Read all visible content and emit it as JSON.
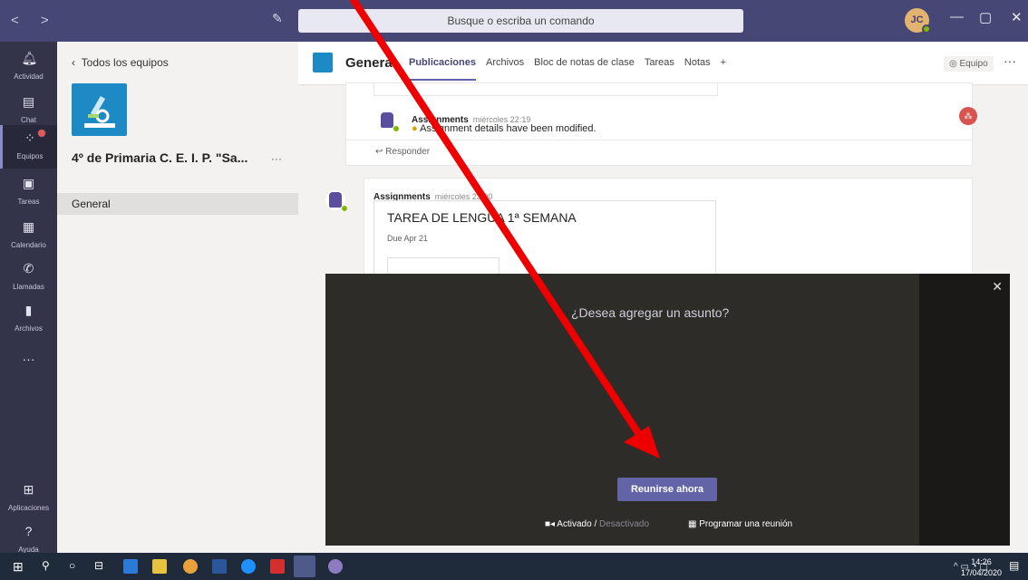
{
  "topbar": {
    "search_placeholder": "Busque o escriba un comando",
    "avatar_initials": "JC",
    "accent": "#464775"
  },
  "rail": {
    "items": [
      {
        "label": "Actividad",
        "icon": "bell-icon"
      },
      {
        "label": "Chat",
        "icon": "chat-icon"
      },
      {
        "label": "Equipos",
        "icon": "teams-icon"
      },
      {
        "label": "Tareas",
        "icon": "backpack-icon"
      },
      {
        "label": "Calendario",
        "icon": "calendar-icon"
      },
      {
        "label": "Llamadas",
        "icon": "phone-icon"
      },
      {
        "label": "Archivos",
        "icon": "file-icon"
      },
      {
        "label": "Aplicaciones",
        "icon": "apps-icon"
      },
      {
        "label": "Ayuda",
        "icon": "help-icon"
      }
    ]
  },
  "panel": {
    "back_label": "Todos los equipos",
    "team_name": "4º de Primaria C. E. I. P. \"Sa...",
    "channel": "General"
  },
  "header": {
    "channel_title": "General",
    "tabs": [
      "Publicaciones",
      "Archivos",
      "Bloc de notas de clase",
      "Tareas",
      "Notas",
      "+"
    ],
    "team_button": "Equipo"
  },
  "posts": [
    {
      "author": "Assignments",
      "time": "miércoles 22:19",
      "text": "Assignment details have been modified.",
      "reply": "Responder"
    },
    {
      "author": "Assignments",
      "time": "miércoles 23:00",
      "title": "TAREA DE LENGUA 1ª SEMANA",
      "due": "Due Apr 21"
    }
  ],
  "meeting": {
    "subject_placeholder": "¿Desea agregar un asunto?",
    "join_label": "Reunirse ahora",
    "camera_on": "Activado",
    "camera_sep": "/",
    "camera_off": "Desactivado",
    "schedule_label": "Programar una reunión"
  },
  "taskbar": {
    "time": "14:26",
    "date": "17/04/2020"
  }
}
